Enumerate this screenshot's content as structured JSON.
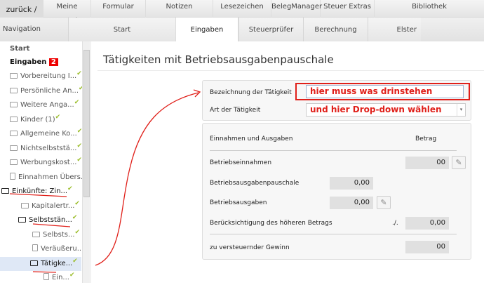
{
  "topnav": {
    "back": "zurück / vor",
    "items": [
      "Meine Zentrale",
      "Formular",
      "Notizen",
      "Lesezeichen",
      "BelegManager",
      "Steuer Extras",
      "Bibliothek"
    ]
  },
  "tabs": {
    "navigation": "Navigation",
    "items": [
      "Start",
      "Eingaben",
      "Steuerprüfer",
      "Berechnung",
      "Elster"
    ],
    "active": "Eingaben"
  },
  "sidebar": {
    "start": "Start",
    "eingaben": "Eingaben",
    "badge": "2",
    "items": [
      {
        "label": "Vorbereitung I...",
        "icon": "folder",
        "check": true
      },
      {
        "label": "Persönliche An...",
        "icon": "folder",
        "check": true
      },
      {
        "label": "Weitere Anga...",
        "icon": "folder",
        "check": true
      },
      {
        "label": "Kinder (1)",
        "icon": "folder",
        "check": true
      },
      {
        "label": "Allgemeine Ko...",
        "icon": "folder",
        "check": true
      },
      {
        "label": "Nichtselbststä...",
        "icon": "folder",
        "check": true
      },
      {
        "label": "Werbungskost...",
        "icon": "folder",
        "check": true
      },
      {
        "label": "Einnahmen Übers...",
        "icon": "document",
        "check": false
      },
      {
        "label": "Einkünfte: Zin...",
        "icon": "folder-open",
        "check": true
      },
      {
        "label": "Kapitalertr...",
        "icon": "folder",
        "check": true
      },
      {
        "label": "Selbststän...",
        "icon": "folder-open",
        "check": true
      },
      {
        "label": "Selbsts...",
        "icon": "folder",
        "check": true
      },
      {
        "label": "Veräußeru...",
        "icon": "document",
        "check": false
      },
      {
        "label": "Tätigke...",
        "icon": "folder-open",
        "check": true
      },
      {
        "label": "Ein...",
        "icon": "document",
        "check": true
      }
    ]
  },
  "main": {
    "title": "Tätigkeiten mit Betriebsausgabenpauschale",
    "bezeichnung_label": "Bezeichnung der Tätigkeit",
    "bezeichnung_value": "hier muss was drinstehen",
    "art_label": "Art der Tätigkeit",
    "art_value": "und hier Drop-down wählen",
    "section_header": "Einnahmen und Ausgaben",
    "betrag_header": "Betrag",
    "rows": {
      "einnahmen_label": "Betriebseinnahmen",
      "einnahmen_value": "00",
      "pauschale_label": "Betriebsausgabenpauschale",
      "pauschale_value": "0,00",
      "ausgaben_label": "Betriebsausgaben",
      "ausgaben_value": "0,00",
      "hoeher_label": "Berücksichtigung des höheren Betrags",
      "hoeher_prefix": "./.",
      "hoeher_value": "0,00",
      "gewinn_label": "zu versteuernder Gewinn",
      "gewinn_value": "00"
    }
  },
  "colors": {
    "annotation": "#e0201a",
    "check": "#9bbd2a"
  }
}
